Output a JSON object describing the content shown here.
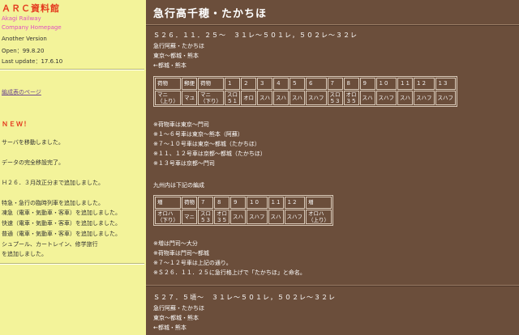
{
  "sidebar": {
    "site_title": "ＡＲＣ資料館",
    "site_sub1": "Akagi Railway",
    "site_sub2": "Company Homepage",
    "version": "Another Version",
    "open": "Open：99.8.20",
    "last_update": "Last update：17.6.10",
    "formation_link": "編成表のページ",
    "new_heading": "ＮＥＷ！",
    "news": [
      "サーバを移動しました。",
      "データの完全移設完了。",
      "Ｈ２６．３月改正分まで追加しました。",
      "特急・急行の臨時列車を追加しました。",
      "凍急（電車・気動車・客車）を追加しました。",
      "快速（電車・気動車・客車）を追加しました。",
      "普通（電車・気動車・客車）を追加しました。",
      "シュプール、カートレイン、修学旅行",
      "を追加しました。"
    ]
  },
  "main": {
    "title": "急行高千穂・たかちほ",
    "section1": {
      "heading": "Ｓ２６．１１．２５～　３１レ～５０１レ，５０２レ～３２レ",
      "lines": [
        "急行阿蘇・たかちほ",
        "東京～都城・熊本",
        "←都城・熊本"
      ],
      "table": {
        "header": [
          "荷物",
          "郵便",
          "荷物",
          "１",
          "２",
          "３",
          "４",
          "５",
          "６",
          "７",
          "８",
          "９",
          "１０",
          "１１",
          "１２",
          "１３"
        ],
        "row": [
          [
            "マニ",
            "（上り）"
          ],
          [
            "マユ"
          ],
          [
            "マニ",
            "（下り）"
          ],
          [
            "スロ",
            "５１"
          ],
          [
            "オロ"
          ],
          [
            "スハ"
          ],
          [
            "スハ"
          ],
          [
            "スハ"
          ],
          [
            "スハフ"
          ],
          [
            "スロ",
            "５３"
          ],
          [
            "オロ",
            "３５"
          ],
          [
            "スハ"
          ],
          [
            "スハフ"
          ],
          [
            "スハ"
          ],
          [
            "スハフ"
          ],
          [
            "スハフ"
          ]
        ]
      },
      "notes": [
        "※荷物車は東京～門司",
        "※１～６号車は東京～熊本（阿蘇）",
        "※７～１０号車は東京～都城（たかちほ）",
        "※１１、１２号車は京都～都城（たかちほ）",
        "※１３号車は京都～門司"
      ],
      "kyushu_caption": "九州内は下記の編成",
      "table2": {
        "header": [
          "増",
          "荷物",
          "７",
          "８",
          "９",
          "１０",
          "１１",
          "１２",
          "増"
        ],
        "row": [
          [
            "オロハ",
            "（下り）"
          ],
          [
            "マニ"
          ],
          [
            "スロ",
            "５３"
          ],
          [
            "オロ",
            "３５"
          ],
          [
            "スハ"
          ],
          [
            "スハフ"
          ],
          [
            "スハ"
          ],
          [
            "スハフ"
          ],
          [
            "オロハ",
            "（上り）"
          ]
        ]
      },
      "notes2": [
        "※増は門司～大分",
        "※荷物車は門司～都城",
        "※７～１２号車は上記の通り。",
        "※Ｓ２６．１１．２５に急行格上げで「たかちほ」と命名。"
      ]
    },
    "section2": {
      "heading": "Ｓ２７．５頃～　３１レ～５０１レ，５０２レ～３２レ",
      "lines": [
        "急行阿蘇・たかちほ",
        "東京～都城・熊本",
        "←都城・熊本"
      ]
    }
  }
}
